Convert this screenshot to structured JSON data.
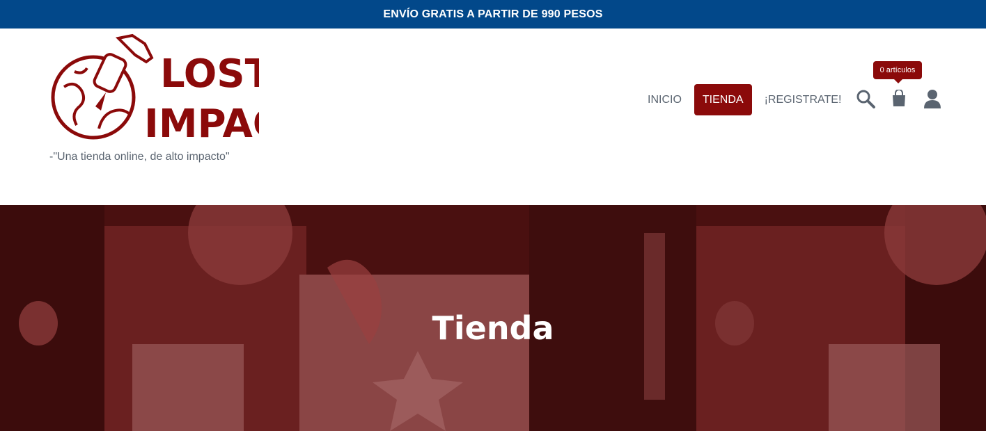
{
  "promo": {
    "text": "ENVÍO GRATIS A PARTIR DE 990 PESOS"
  },
  "brand": {
    "logo_line1": "LOST",
    "logo_line2": "IMPACT",
    "tagline": "-\"Una tienda online, de alto impacto\"",
    "color": "#8b0a0a"
  },
  "nav": {
    "items": [
      {
        "label": "INICIO"
      },
      {
        "label": "TIENDA"
      },
      {
        "label": "¡REGISTRATE!"
      }
    ],
    "active": "TIENDA"
  },
  "cart": {
    "badge": "0 artículos"
  },
  "icons": [
    "search-icon",
    "shopping-bag-icon",
    "user-icon"
  ],
  "hero": {
    "title": "Tienda"
  },
  "colors": {
    "promo_bg": "#02488a",
    "accent": "#8b0a0a",
    "hero_bg": "#5b1414"
  }
}
